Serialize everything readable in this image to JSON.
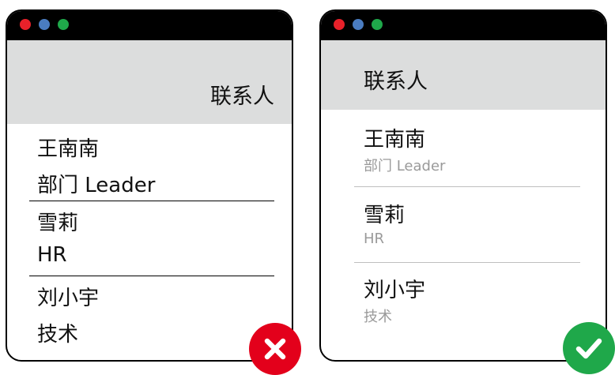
{
  "colors": {
    "dot_red": "#e8212a",
    "dot_blue": "#4a7cc0",
    "dot_green": "#1fa84a",
    "header_bg": "#dcdddd",
    "wrong_badge": "#e3001b",
    "correct_badge": "#1fa84a",
    "secondary_text": "#9a9a9a"
  },
  "left_panel": {
    "header_title": "联系人",
    "contacts": [
      {
        "name": "王南南",
        "role": "部门 Leader"
      },
      {
        "name": "雪莉",
        "role": "HR"
      },
      {
        "name": "刘小宇",
        "role": "技术"
      }
    ],
    "badge_icon": "cross-icon"
  },
  "right_panel": {
    "header_title": "联系人",
    "contacts": [
      {
        "name": "王南南",
        "role": "部门 Leader"
      },
      {
        "name": "雪莉",
        "role": "HR"
      },
      {
        "name": "刘小宇",
        "role": "技术"
      }
    ],
    "badge_icon": "check-icon"
  }
}
